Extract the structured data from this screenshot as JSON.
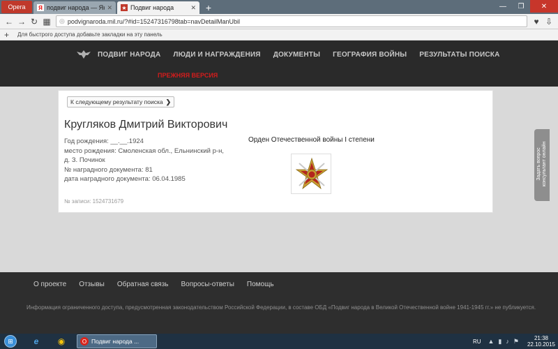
{
  "browser": {
    "opera_button": "Opera",
    "tabs": [
      {
        "label": "подвиг народа — Яндек",
        "favicon": "Я"
      },
      {
        "label": "Подвиг народа",
        "favicon": "★"
      }
    ],
    "url": "podvignaroda.mil.ru/?#id=15247316798tab=navDetailManUbil",
    "bookmarks_hint": "Для быстрого доступа добавьте закладки на эту панель"
  },
  "site": {
    "nav": [
      "ПОДВИГ НАРОДА",
      "ЛЮДИ И НАГРАЖДЕНИЯ",
      "ДОКУМЕНТЫ",
      "ГЕОГРАФИЯ ВОЙНЫ",
      "РЕЗУЛЬТАТЫ ПОИСКА"
    ],
    "old_version": "ПРЕЖНЯЯ ВЕРСИЯ"
  },
  "record": {
    "next_result_button": "К следующему результату поиска",
    "name": "Кругляков Дмитрий Викторович",
    "birth_year": "Год рождения: __.__.1924",
    "birth_place_line1": "место рождения: Смоленская обл., Ельнинский р-н,",
    "birth_place_line2": "д. З. Починок",
    "award_doc_number": "№ наградного документа: 81",
    "award_doc_date": "дата наградного документа: 06.04.1985",
    "record_number": "№ записи: 1524731679",
    "award_title": "Орден Отечественной войны I степени"
  },
  "side_tab": {
    "line1": "Задать вопрос",
    "line2": "консультант онлайн"
  },
  "footer": {
    "links": [
      "О проекте",
      "Отзывы",
      "Обратная связь",
      "Вопросы-ответы",
      "Помощь"
    ],
    "disclaimer": "Информация ограниченного доступа, предусмотренная законодательством Российской Федерации, в составе ОБД «Подвиг народа в Великой Отечественной войне 1941-1945 гг.» не публикуется."
  },
  "taskbar": {
    "app_label": "Подвиг народа ...",
    "language": "RU",
    "time": "21:38",
    "date": "22.10.2015"
  }
}
